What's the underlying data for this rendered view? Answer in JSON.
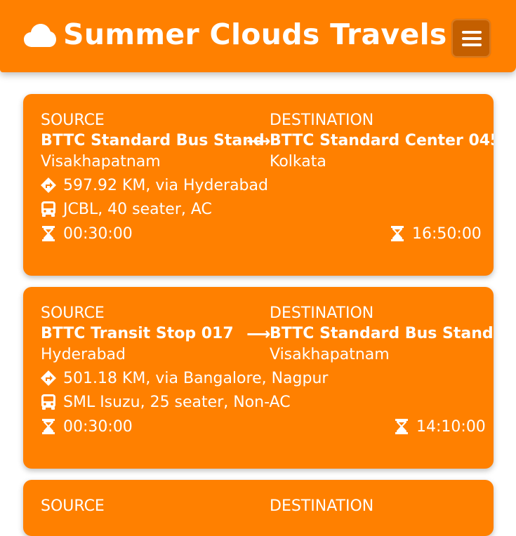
{
  "header": {
    "title": "Summer Clouds Travels",
    "brand_icon": "cloud-icon",
    "menu_icon": "hamburger-icon"
  },
  "colors": {
    "accent": "#ff8000",
    "menu_button": "#c45f00",
    "text": "#ffffff"
  },
  "routes": [
    {
      "source_label": "SOURCE",
      "source_name": "BTTC Standard Bus Stand",
      "source_city": "Visakhapatnam",
      "destination_label": "DESTINATION",
      "destination_name": "BTTC Standard Center 045",
      "destination_city": "Kolkata",
      "distance": "597.92 KM, via Hyderabad",
      "bus": "JCBL, 40 seater, AC",
      "departure": "00:30:00",
      "arrival": "16:50:00"
    },
    {
      "source_label": "SOURCE",
      "source_name": "BTTC Transit Stop 017",
      "source_city": "Hyderabad",
      "destination_label": "DESTINATION",
      "destination_name": "BTTC Standard Bus Stand",
      "destination_city": "Visakhapatnam",
      "distance": "501.18 KM, via Bangalore, Nagpur",
      "bus": "SML Isuzu, 25 seater, Non-AC",
      "departure": "00:30:00",
      "arrival": "14:10:00"
    },
    {
      "source_label": "SOURCE",
      "destination_label": "DESTINATION"
    }
  ]
}
